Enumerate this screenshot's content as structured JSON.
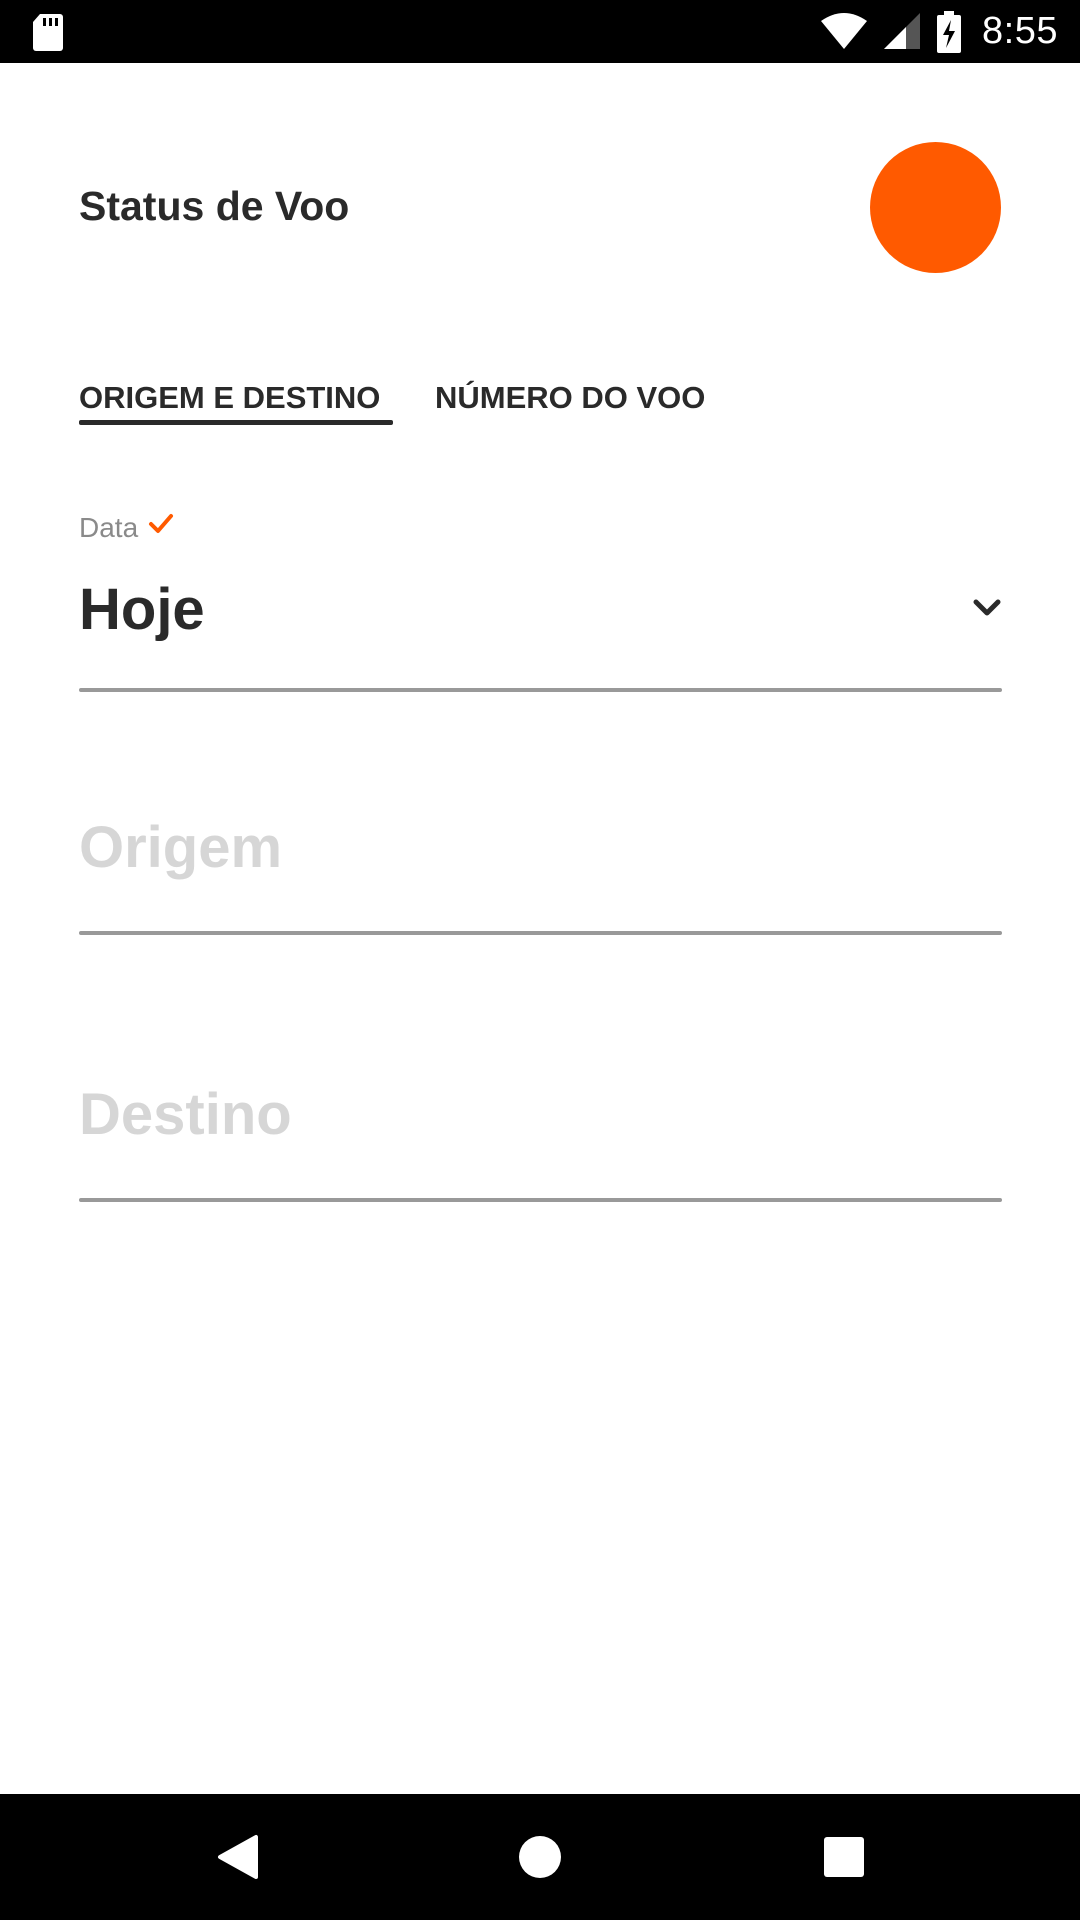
{
  "status_bar": {
    "time": "8:55",
    "icons": [
      "sd-card-icon",
      "wifi-icon",
      "signal-icon",
      "battery-charging-icon"
    ]
  },
  "header": {
    "title": "Status de Voo",
    "avatar_color": "#ff5a00"
  },
  "tabs": [
    {
      "label": "ORIGEM E DESTINO",
      "selected": true
    },
    {
      "label": "NÚMERO DO VOO",
      "selected": false
    }
  ],
  "form": {
    "date": {
      "label": "Data",
      "value": "Hoje",
      "validated": true
    },
    "origin": {
      "placeholder": "Origem",
      "value": ""
    },
    "destination": {
      "placeholder": "Destino",
      "value": ""
    }
  },
  "colors": {
    "accent": "#ff5a00",
    "text_primary": "#2a2a2a",
    "label_gray": "#8a8a8a",
    "placeholder_gray": "#d6d6d6",
    "underline_gray": "#999999"
  },
  "nav_bar": {
    "icons": [
      "back-icon",
      "home-icon",
      "recents-icon"
    ]
  }
}
